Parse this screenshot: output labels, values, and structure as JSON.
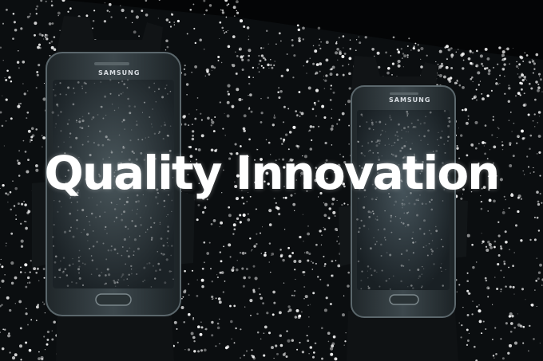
{
  "scene": {
    "headline": "Quality Innovation",
    "phones": [
      {
        "brand": "SAMSUNG"
      },
      {
        "brand": "SAMSUNG"
      }
    ]
  },
  "colors": {
    "background": "#0a0c0e",
    "screen_panel": "#2f3b40",
    "phone_body": "#3a4448",
    "droplets": "#ffffff",
    "headline": "#ffffff"
  }
}
